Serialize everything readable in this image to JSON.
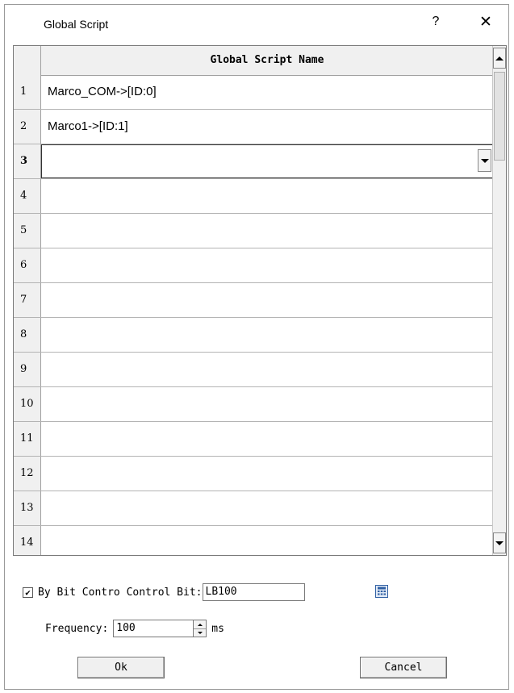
{
  "window": {
    "title": "Global Script",
    "help_label": "?",
    "close_label": "✕"
  },
  "grid": {
    "column_header": "Global Script Name",
    "rows": [
      {
        "num": "1",
        "name": "Marco_COM->[ID:0]"
      },
      {
        "num": "2",
        "name": "Marco1->[ID:1]"
      },
      {
        "num": "3",
        "name": ""
      },
      {
        "num": "4",
        "name": ""
      },
      {
        "num": "5",
        "name": ""
      },
      {
        "num": "6",
        "name": ""
      },
      {
        "num": "7",
        "name": ""
      },
      {
        "num": "8",
        "name": ""
      },
      {
        "num": "9",
        "name": ""
      },
      {
        "num": "10",
        "name": ""
      },
      {
        "num": "11",
        "name": ""
      },
      {
        "num": "12",
        "name": ""
      },
      {
        "num": "13",
        "name": ""
      },
      {
        "num": "14",
        "name": ""
      }
    ],
    "active_row": "3"
  },
  "options": {
    "by_bit_checked": true,
    "by_bit_label": "By Bit Contro Control Bit:",
    "control_bit_value": "LB100",
    "frequency_label": "Frequency:",
    "frequency_value": "100",
    "frequency_unit": "ms"
  },
  "buttons": {
    "ok": "Ok",
    "cancel": "Cancel"
  }
}
